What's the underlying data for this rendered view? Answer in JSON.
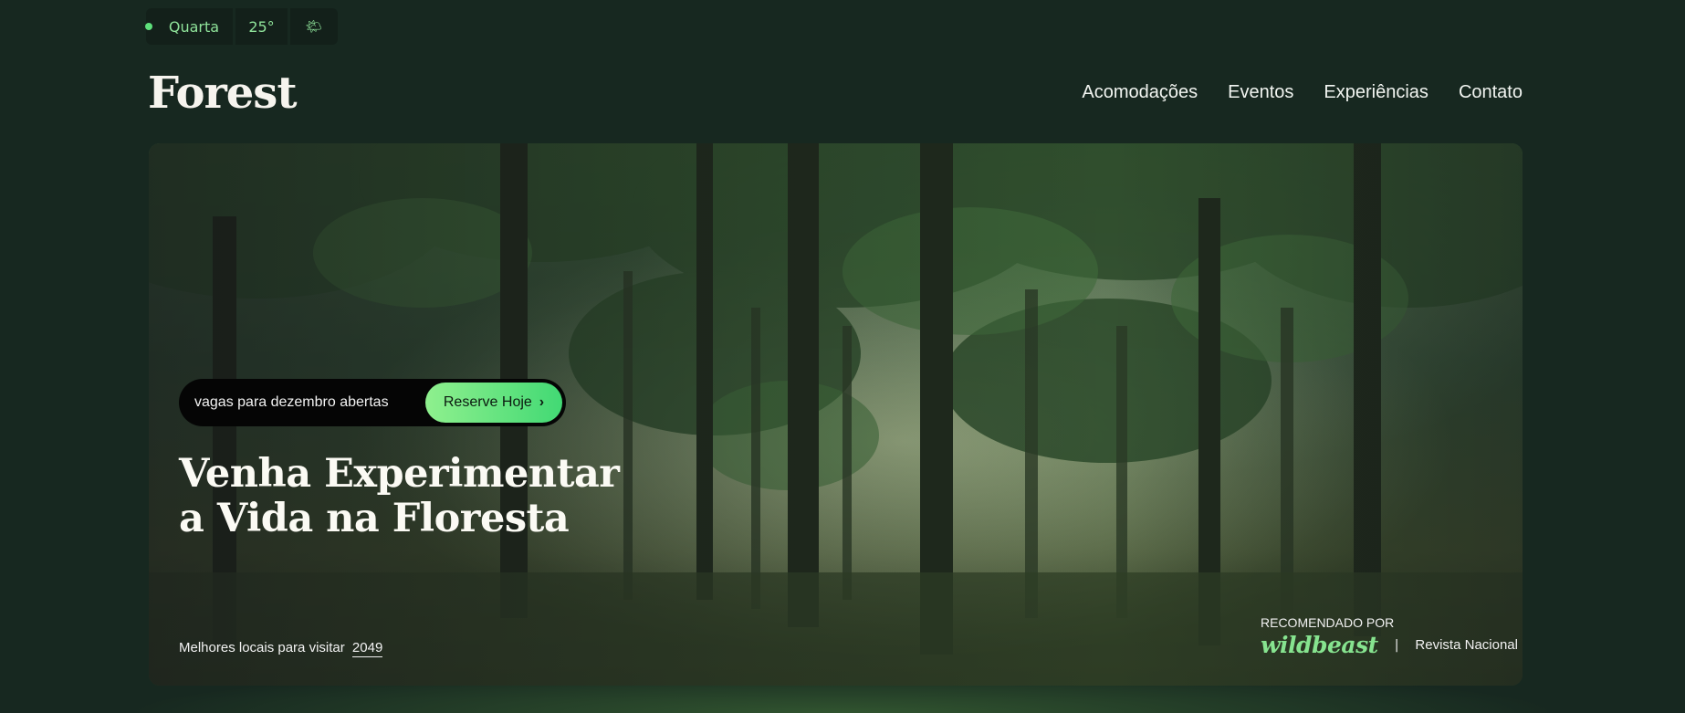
{
  "weather": {
    "day": "Quarta",
    "temperature": "25°",
    "icon": "sun-behind-cloud-icon",
    "icon_glyph": "🌤"
  },
  "header": {
    "logo": "Forest",
    "nav": [
      "Acomodações",
      "Eventos",
      "Experiências",
      "Contato"
    ]
  },
  "hero": {
    "availability_text": "vagas para dezembro abertas",
    "cta_label": "Reserve Hoje",
    "headline_line1": "Venha Experimentar",
    "headline_line2": "a Vida na Floresta",
    "best_places_text": "Melhores locais para visitar",
    "best_places_year": "2049",
    "recommended_label": "RECOMENDADO POR",
    "recommended_brand": "wildbeast",
    "separator": "|",
    "recommended_source": "Revista Nacional"
  },
  "colors": {
    "background": "#172820",
    "accent_green": "#5ee07b",
    "button_gradient_start": "#8ff08e",
    "button_gradient_end": "#42d974"
  }
}
